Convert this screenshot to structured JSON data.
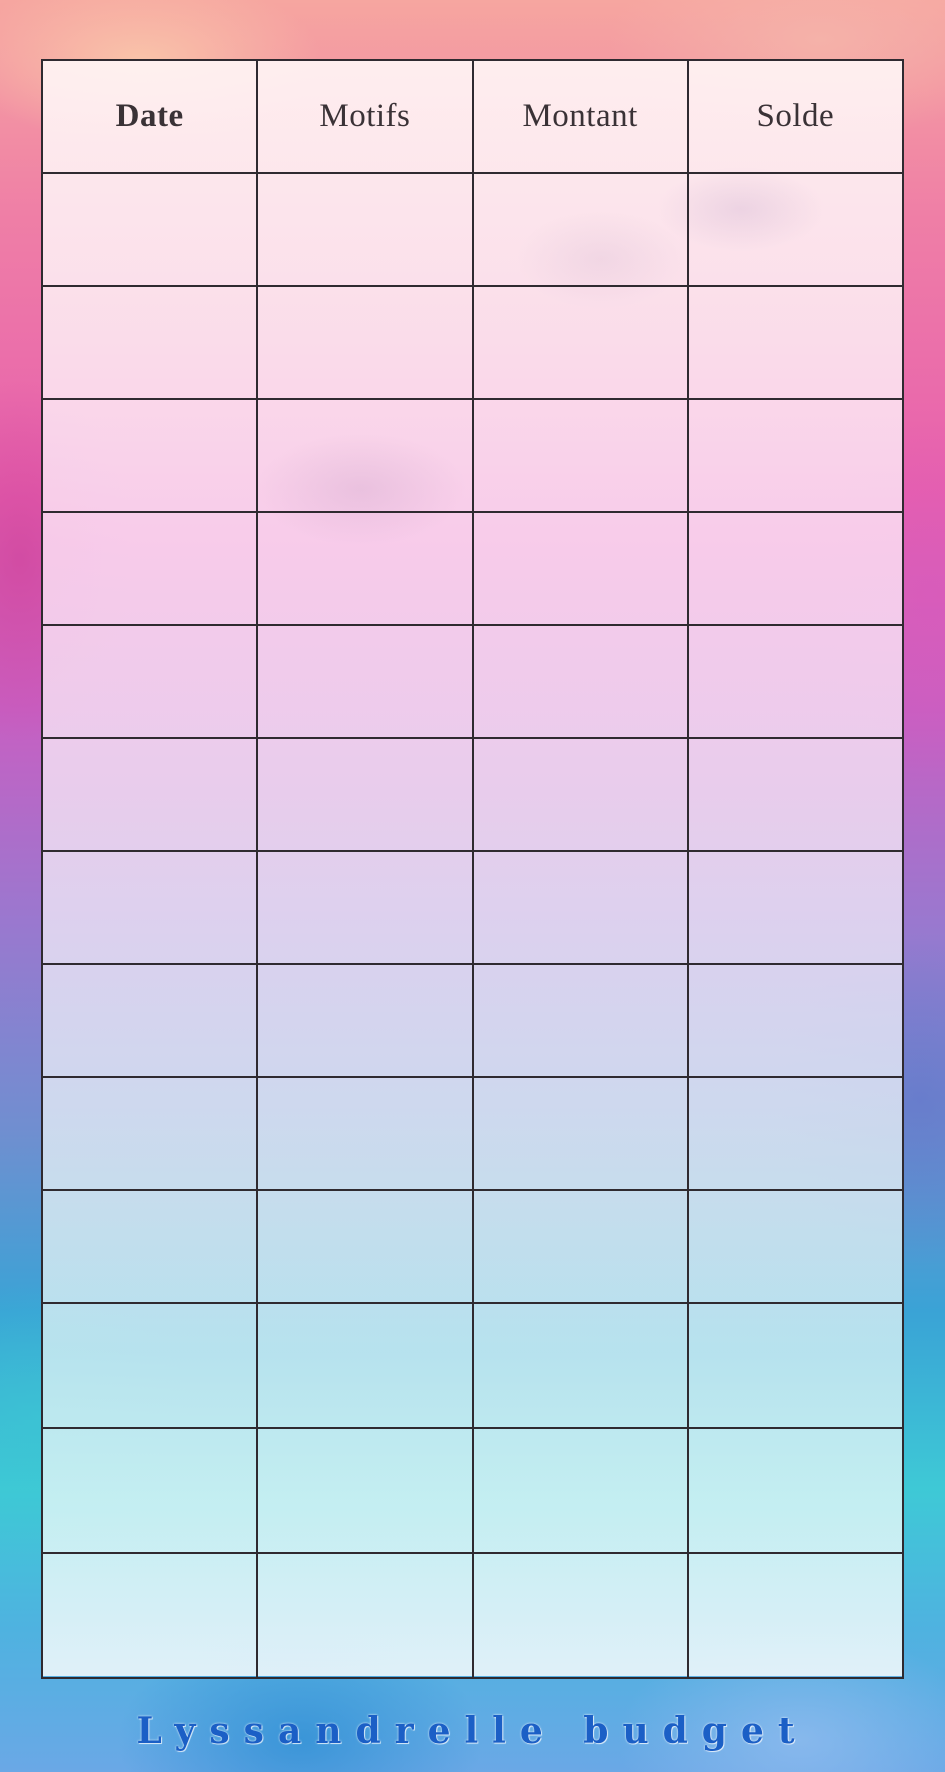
{
  "table": {
    "headers": [
      {
        "label": "Date"
      },
      {
        "label": "Motifs"
      },
      {
        "label": "Montant"
      },
      {
        "label": "Solde"
      }
    ],
    "rows": [
      [
        "",
        "",
        "",
        ""
      ],
      [
        "",
        "",
        "",
        ""
      ],
      [
        "",
        "",
        "",
        ""
      ],
      [
        "",
        "",
        "",
        ""
      ],
      [
        "",
        "",
        "",
        ""
      ],
      [
        "",
        "",
        "",
        ""
      ],
      [
        "",
        "",
        "",
        ""
      ],
      [
        "",
        "",
        "",
        ""
      ],
      [
        "",
        "",
        "",
        ""
      ],
      [
        "",
        "",
        "",
        ""
      ],
      [
        "",
        "",
        "",
        ""
      ],
      [
        "",
        "",
        "",
        ""
      ],
      [
        "",
        "",
        "",
        ""
      ]
    ]
  },
  "footer": {
    "brand": "Lyssandrelle budget"
  },
  "colors": {
    "grid_line": "#2f2a30",
    "header_text": "#3a3236",
    "brand_text": "#1b5fc6"
  }
}
